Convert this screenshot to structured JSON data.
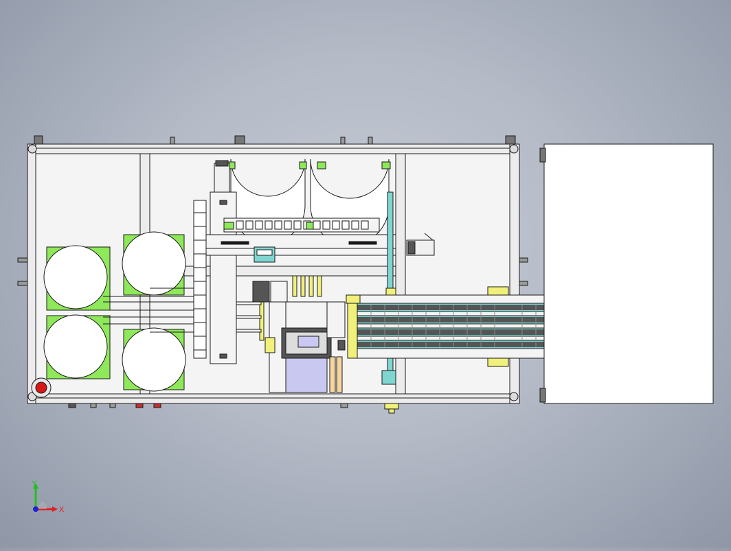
{
  "viewport": {
    "background": "#b4bac6",
    "line_color": "#1a1a1a",
    "part_colors": {
      "frame": "#f4f4f4",
      "green": "#8ee85a",
      "cyan": "#7fd6d0",
      "yellow": "#f0f07a",
      "lavender": "#c8c8f0",
      "dark_grey": "#555555",
      "red": "#d81818"
    }
  },
  "triad": {
    "x_label": "X",
    "y_label": "Y",
    "x_color": "#e02020",
    "y_color": "#20c020",
    "z_color": "#2020d0"
  }
}
